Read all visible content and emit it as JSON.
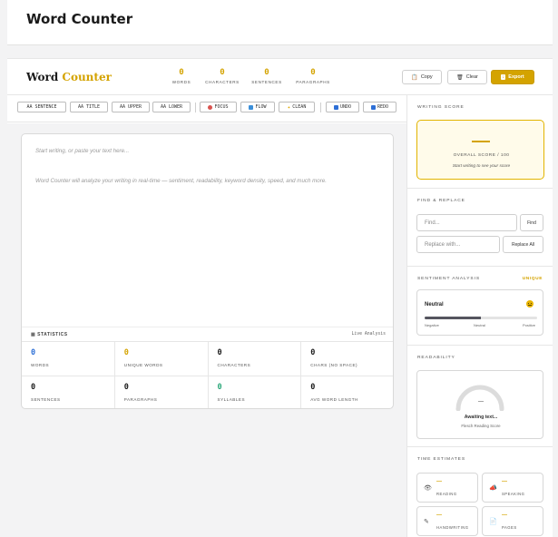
{
  "page": {
    "title": "Word Counter"
  },
  "brand": {
    "part1": "Word",
    "part2": "Counter"
  },
  "top_stats": [
    {
      "value": "0",
      "label": "WORDS"
    },
    {
      "value": "0",
      "label": "CHARACTERS"
    },
    {
      "value": "0",
      "label": "SENTENCES"
    },
    {
      "value": "0",
      "label": "PARAGRAPHS"
    }
  ],
  "actions": {
    "copy": "Copy",
    "clear": "Clear",
    "export": "Export"
  },
  "toolbar": {
    "sentence": "AA SENTENCE",
    "title": "AA TITLE",
    "upper": "AA UPPER",
    "lower": "AA LOWER",
    "focus": "FOCUS",
    "flow": "FLOW",
    "clean": "CLEAN",
    "undo": "UNDO",
    "redo": "REDO"
  },
  "editor": {
    "placeholder_line1": "Start writing, or paste your text here...",
    "placeholder_line2": "Word Counter will analyze your writing in real-time — sentiment, readability, keyword density, speed, and much more."
  },
  "statistics": {
    "title": "STATISTICS",
    "mode": "Live Analysis",
    "cells": [
      {
        "value": "0",
        "label": "WORDS"
      },
      {
        "value": "0",
        "label": "UNIQUE WORDS"
      },
      {
        "value": "0",
        "label": "CHARACTERS"
      },
      {
        "value": "0",
        "label": "CHARS (NO SPACE)"
      },
      {
        "value": "0",
        "label": "SENTENCES"
      },
      {
        "value": "0",
        "label": "PARAGRAPHS"
      },
      {
        "value": "0",
        "label": "SYLLABLES"
      },
      {
        "value": "0",
        "label": "AVG WORD LENGTH"
      }
    ]
  },
  "writing_score": {
    "title": "WRITING SCORE",
    "value": "—",
    "label": "OVERALL SCORE / 100",
    "sub": "Start writing to see your score"
  },
  "find_replace": {
    "title": "FIND & REPLACE",
    "find_placeholder": "Find...",
    "find_button": "Find",
    "replace_placeholder": "Replace with...",
    "replace_button": "Replace All"
  },
  "sentiment": {
    "title": "SENTIMENT ANALYSIS",
    "tag": "UNIQUE",
    "label": "Neutral",
    "bar_fraction": 0.5,
    "scale": [
      "Negative",
      "Neutral",
      "Positive"
    ]
  },
  "readability": {
    "title": "READABILITY",
    "value": "—",
    "status": "Awaiting text...",
    "sub": "Flesch Reading Score"
  },
  "time_estimates": {
    "title": "TIME ESTIMATES",
    "items": [
      {
        "icon": "eye-icon",
        "value": "—",
        "label": "READING"
      },
      {
        "icon": "megaphone-icon",
        "value": "—",
        "label": "SPEAKING"
      },
      {
        "icon": "pencil-icon",
        "value": "—",
        "label": "HANDWRITING"
      },
      {
        "icon": "page-icon",
        "value": "—",
        "label": "PAGES"
      }
    ]
  },
  "colors": {
    "accent": "#d4a300",
    "blue": "#2d6fd6",
    "green": "#2ca87a"
  }
}
